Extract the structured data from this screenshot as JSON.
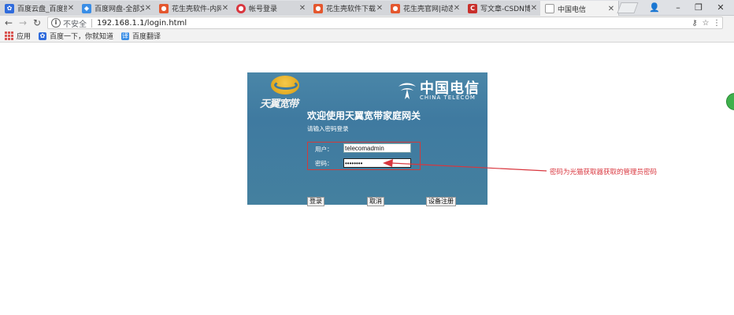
{
  "tabs": [
    {
      "title": "百度云盘_百度搜索",
      "favicon": "baidu-paw-icon",
      "color": "#2f6bdc"
    },
    {
      "title": "百度网盘-全部文件",
      "favicon": "baidu-netdisk-icon",
      "color": "#3a8ee6"
    },
    {
      "title": "花生壳软件-内网穿透",
      "favicon": "oray-icon",
      "color": "#e4572e"
    },
    {
      "title": "帐号登录",
      "favicon": "oray-account-icon",
      "color": "#d9363e"
    },
    {
      "title": "花生壳软件下载-内网",
      "favicon": "oray-icon",
      "color": "#e4572e"
    },
    {
      "title": "花生壳官网|动态域名",
      "favicon": "oray-icon",
      "color": "#e4572e"
    },
    {
      "title": "写文章-CSDN博客",
      "favicon": "csdn-icon",
      "color": "#c9302c"
    },
    {
      "title": "中国电信",
      "favicon": "page-icon",
      "color": "#888888",
      "active": true
    }
  ],
  "window_controls": {
    "user": "👤",
    "minimize": "–",
    "restore": "❐",
    "close": "✕"
  },
  "toolbar": {
    "security_label": "不安全",
    "url": "192.168.1.1/login.html"
  },
  "bookmarks": [
    {
      "label": "应用",
      "icon": "apps-grid-icon"
    },
    {
      "label": "百度一下，你就知道",
      "icon": "baidu-paw-icon"
    },
    {
      "label": "百度翻译",
      "icon": "baidu-translate-icon"
    }
  ],
  "login": {
    "brand_tianyi": "天翼宽带",
    "brand_ct_cn": "中国电信",
    "brand_ct_en": "CHINA TELECOM",
    "welcome": "欢迎使用天翼宽带家庭网关",
    "hint": "请输入密码登录",
    "user_label": "用户：",
    "user_value": "telecomadmin",
    "pass_label": "密码：",
    "pass_value": "••••••••",
    "login_button": "登录",
    "cancel_button": "取消",
    "register_button": "设备注册"
  },
  "annotation": {
    "text": "密码为光猫获取器获取的管理员密码",
    "color": "#d9363e"
  }
}
